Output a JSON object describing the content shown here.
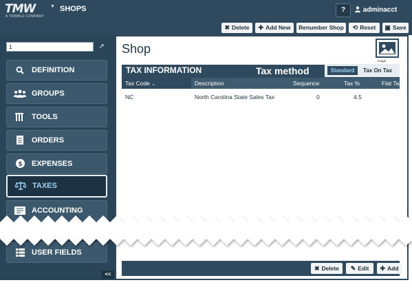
{
  "header": {
    "logo_text": "TMW",
    "logo_subtext": "A TRIMBLE COMPANY",
    "app_title": "SHOPS",
    "help_label": "?",
    "user_name": "adminacct"
  },
  "toolbar": {
    "delete": "Delete",
    "add_new": "Add New",
    "renumber": "Renumber Shop",
    "reset": "Reset",
    "save": "Save"
  },
  "sidebar": {
    "search_value": "1",
    "items": [
      {
        "label": "DEFINITION",
        "icon": "search-icon"
      },
      {
        "label": "GROUPS",
        "icon": "group-icon"
      },
      {
        "label": "TOOLS",
        "icon": "tools-icon"
      },
      {
        "label": "ORDERS",
        "icon": "document-icon"
      },
      {
        "label": "EXPENSES",
        "icon": "dollar-icon"
      },
      {
        "label": "TAXES",
        "icon": "scale-icon"
      },
      {
        "label": "ACCOUNTING",
        "icon": "ledger-icon"
      },
      {
        "label": "USER FIELDS",
        "icon": "list-icon"
      }
    ],
    "active_item": "TAXES",
    "collapse_label": "<<"
  },
  "main": {
    "title": "Shop",
    "image_label": "Image"
  },
  "tax_section": {
    "title": "TAX INFORMATION",
    "method_label": "Tax method",
    "method_options": [
      "Standard",
      "Tax On Tax"
    ],
    "selected_method": "Standard",
    "columns": [
      "Tax Code",
      "Description",
      "Sequence",
      "Tax %",
      "Flat Tax"
    ],
    "sort_indicator": "⌄",
    "rows": [
      {
        "code": "NC",
        "description": "North Carolina State Sales Tax",
        "sequence": "0",
        "tax_pct": "4.5",
        "flat_tax": ""
      }
    ],
    "footer": {
      "delete": "Delete",
      "edit": "Edit",
      "add": "Add"
    }
  },
  "colors": {
    "header_bg": "#2f4a5e",
    "sidebar_bg": "#2b4558",
    "active_text": "#9fd3f3"
  }
}
